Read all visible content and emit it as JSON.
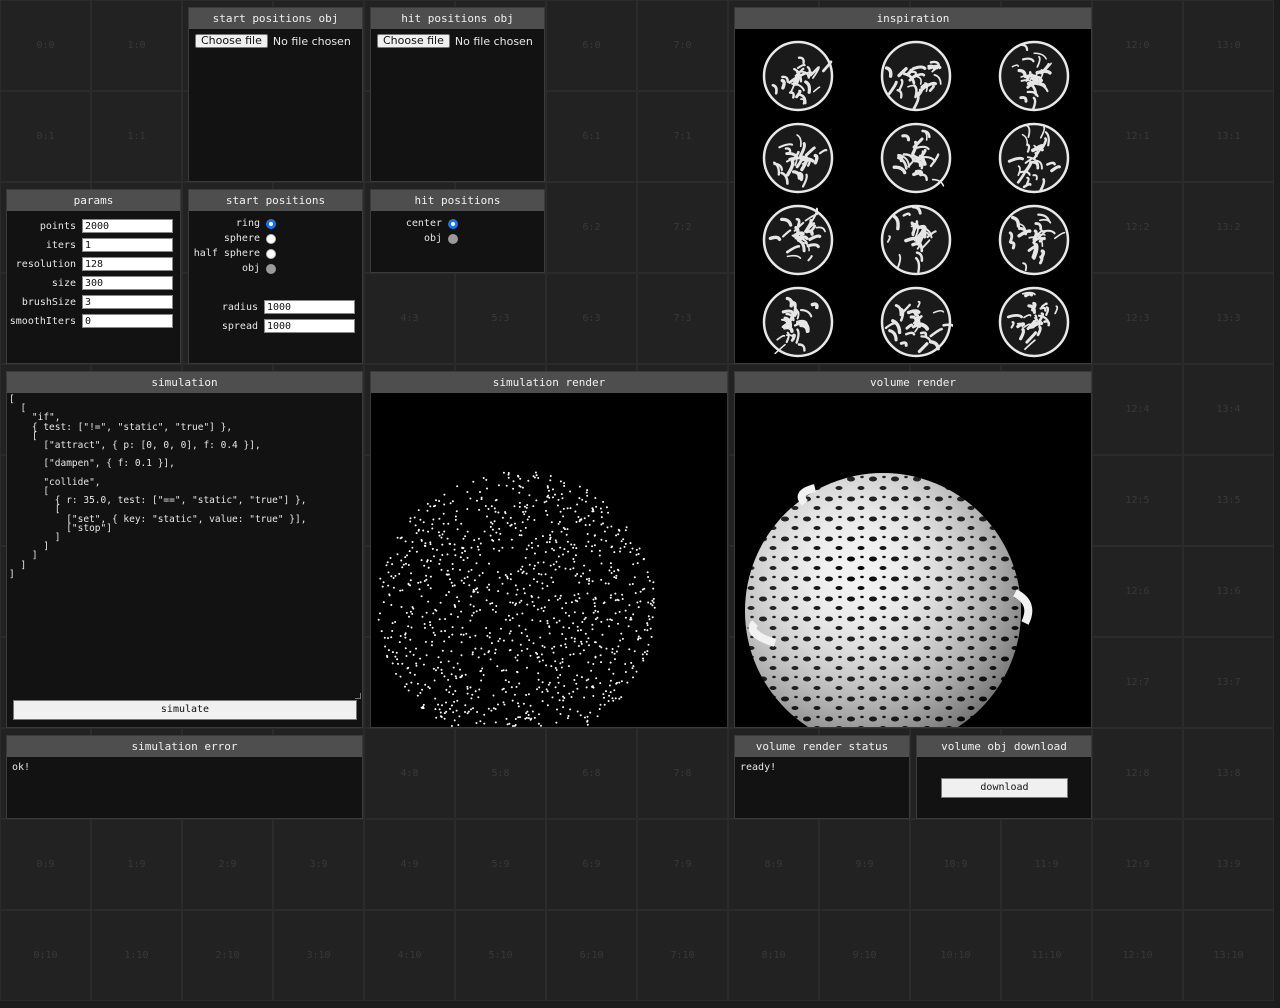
{
  "grid_cells": [
    "0:0",
    "1:0",
    "6:0",
    "7:0",
    "12:0",
    "13:0",
    "0:1",
    "1:1",
    "6:1",
    "7:1",
    "12:1",
    "13:1",
    "6:2",
    "7:2",
    "12:2",
    "13:2",
    "4:3",
    "5:3",
    "6:3",
    "7:3",
    "12:3",
    "13:3",
    "12:4",
    "13:4",
    "12:5",
    "13:5",
    "12:6",
    "13:6",
    "12:7",
    "13:7",
    "4:8",
    "5:8",
    "6:8",
    "7:8",
    "12:8",
    "13:8",
    "0:9",
    "1:9",
    "2:9",
    "3:9",
    "4:9",
    "5:9",
    "6:9",
    "7:9",
    "8:9",
    "9:9",
    "10:9",
    "11:9",
    "12:9",
    "13:9",
    "0:10",
    "1:10",
    "2:10",
    "3:10",
    "4:10",
    "5:10",
    "6:10",
    "7:10",
    "8:10",
    "9:10",
    "10:10",
    "11:10",
    "12:10",
    "13:10"
  ],
  "start_positions_obj": {
    "title": "start positions obj",
    "button_label": "Choose file",
    "status": "No file chosen"
  },
  "hit_positions_obj": {
    "title": "hit positions obj",
    "button_label": "Choose file",
    "status": "No file chosen"
  },
  "inspiration": {
    "title": "inspiration"
  },
  "params": {
    "title": "params",
    "fields": [
      {
        "label": "points",
        "value": "2000"
      },
      {
        "label": "iters",
        "value": "1"
      },
      {
        "label": "resolution",
        "value": "128"
      },
      {
        "label": "size",
        "value": "300"
      },
      {
        "label": "brushSize",
        "value": "3"
      },
      {
        "label": "smoothIters",
        "value": "0"
      }
    ]
  },
  "start_positions": {
    "title": "start positions",
    "options": [
      {
        "label": "ring",
        "state": "selected"
      },
      {
        "label": "sphere",
        "state": "unselected"
      },
      {
        "label": "half sphere",
        "state": "unselected"
      },
      {
        "label": "obj",
        "state": "disabled"
      }
    ],
    "fields": [
      {
        "label": "radius",
        "value": "1000"
      },
      {
        "label": "spread",
        "value": "1000"
      }
    ]
  },
  "hit_positions": {
    "title": "hit positions",
    "options": [
      {
        "label": "center",
        "state": "selected"
      },
      {
        "label": "obj",
        "state": "disabled"
      }
    ]
  },
  "simulation": {
    "title": "simulation",
    "code": "[\n  [\n    \"if\",\n    { test: [\"!=\", \"static\", \"true\"] },\n    [\n      [\"attract\", { p: [0, 0, 0], f: 0.4 }],\n\n      [\"dampen\", { f: 0.1 }],\n\n      \"collide\",\n      [\n        { r: 35.0, test: [\"==\", \"static\", \"true\"] },\n        [\n          [\"set\", { key: \"static\", value: \"true\" }],\n          [\"stop\"]\n        ]\n      ]\n    ]\n  ]\n]",
    "button_label": "simulate"
  },
  "simulation_render": {
    "title": "simulation render"
  },
  "volume_render": {
    "title": "volume render"
  },
  "simulation_error": {
    "title": "simulation error",
    "message": "ok!"
  },
  "volume_render_status": {
    "title": "volume render status",
    "message": "ready!"
  },
  "volume_obj_download": {
    "title": "volume obj download",
    "button_label": "download"
  },
  "colors": {
    "background": "#1c1c1c",
    "panel": "#121212",
    "header": "#4e4e4e",
    "radio_accent": "#1a73e8"
  }
}
